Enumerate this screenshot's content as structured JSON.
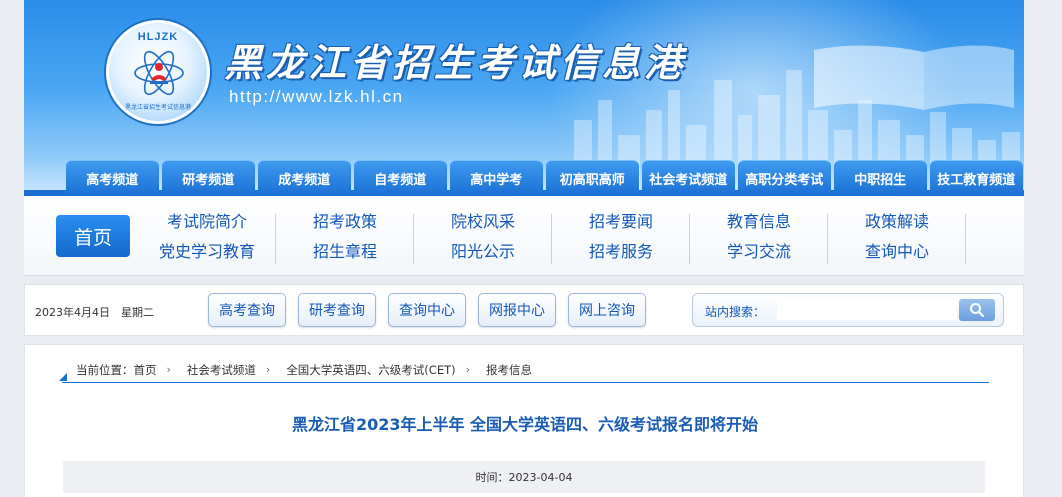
{
  "header": {
    "logo_top": "HLJZK",
    "logo_bottom": "黑龙江省招生考试信息港",
    "site_title": "黑龙江省招生考试信息港",
    "site_url": "http://www.lzk.hl.cn"
  },
  "channels": [
    "高考频道",
    "研考频道",
    "成考频道",
    "自考频道",
    "高中学考",
    "初高职高师",
    "社会考试频道",
    "高职分类考试",
    "中职招生",
    "技工教育频道"
  ],
  "nav": {
    "home": "首页",
    "columns": [
      {
        "top": "考试院简介",
        "bottom": "党史学习教育"
      },
      {
        "top": "招考政策",
        "bottom": "招生章程"
      },
      {
        "top": "院校风采",
        "bottom": "阳光公示"
      },
      {
        "top": "招考要闻",
        "bottom": "招考服务"
      },
      {
        "top": "教育信息",
        "bottom": "学习交流"
      },
      {
        "top": "政策解读",
        "bottom": "查询中心"
      }
    ]
  },
  "toolbar": {
    "date": "2023年4月4日　星期二",
    "buttons": [
      "高考查询",
      "研考查询",
      "查询中心",
      "网报中心",
      "网上咨询"
    ],
    "search_label": "站内搜索：",
    "search_placeholder": ""
  },
  "breadcrumb": {
    "prefix": "当前位置：",
    "items": [
      "首页",
      "社会考试频道",
      "全国大学英语四、六级考试(CET)",
      "报考信息"
    ]
  },
  "article": {
    "title": "黑龙江省2023年上半年 全国大学英语四、六级考试报名即将开始",
    "time": "时间：2023-04-04"
  },
  "colors": {
    "brand_blue": "#1a6fd3",
    "link_blue": "#1358b8",
    "title_blue": "#1a5cb4"
  }
}
